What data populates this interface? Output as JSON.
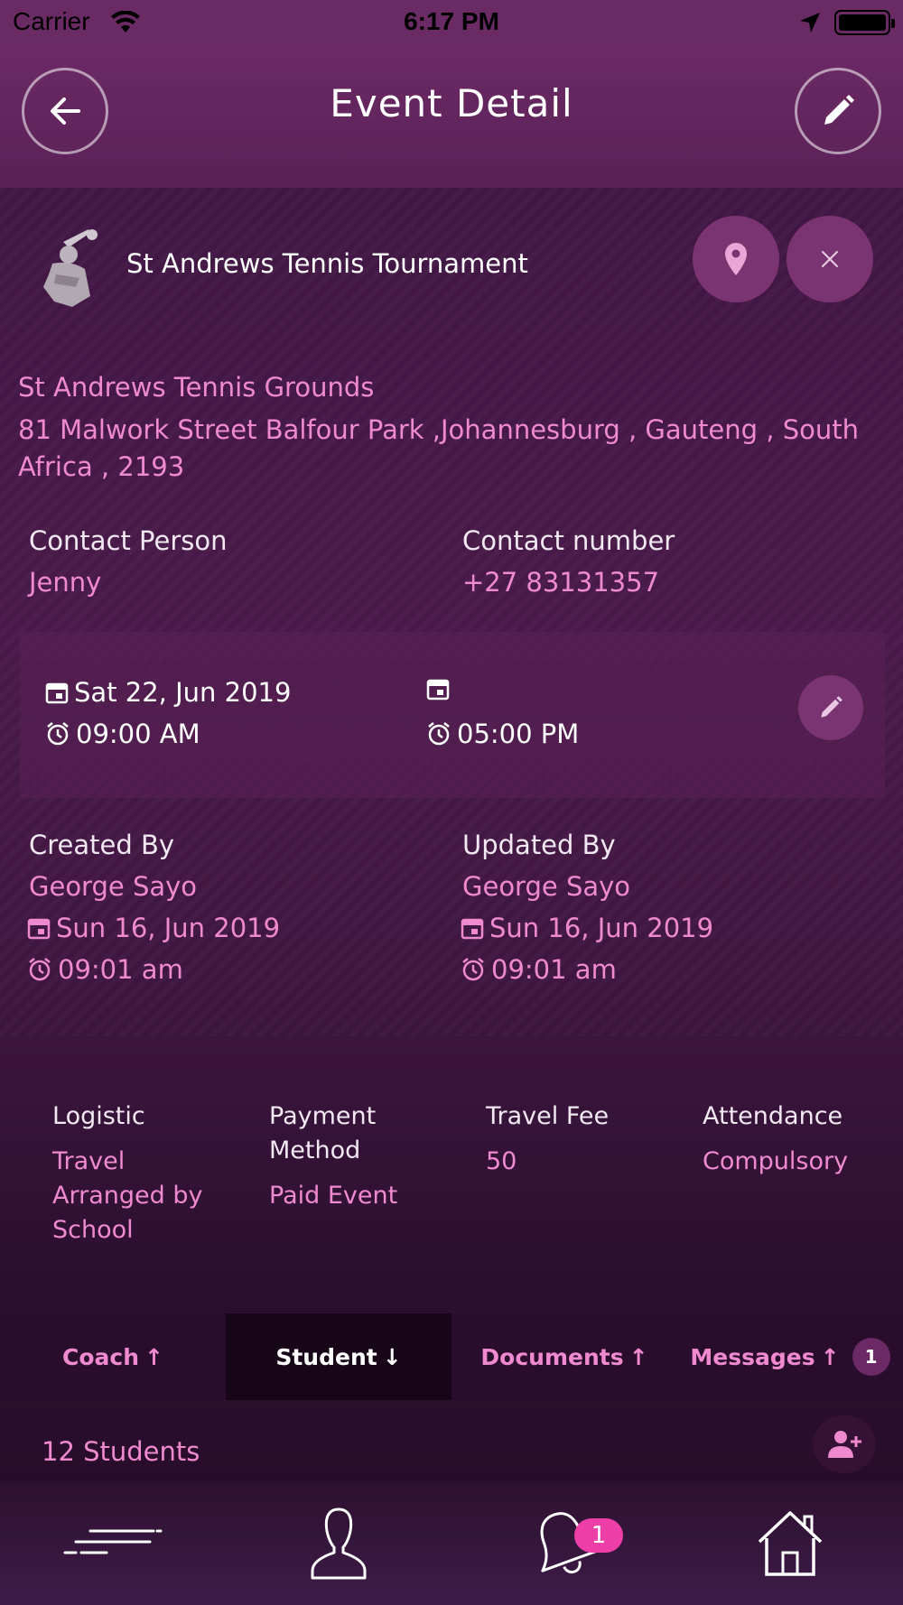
{
  "status_bar": {
    "carrier": "Carrier",
    "time": "6:17 PM"
  },
  "header": {
    "title": "Event Detail"
  },
  "event": {
    "name": "St Andrews Tennis Tournament",
    "venue": "St Andrews Tennis Grounds",
    "address": "81 Malwork Street Balfour Park ,Johannesburg , Gauteng , South Africa , 2193"
  },
  "contact": {
    "person_label": "Contact Person",
    "person_value": "Jenny",
    "number_label": "Contact number",
    "number_value": "+27 83131357"
  },
  "schedule": {
    "start_date": "Sat 22, Jun 2019",
    "start_time": "09:00 AM",
    "end_date": "",
    "end_time": "05:00 PM"
  },
  "audit": {
    "created_label": "Created By",
    "created_name": "George Sayo",
    "created_date": "Sun 16, Jun 2019",
    "created_time": "09:01 am",
    "updated_label": "Updated By",
    "updated_name": "George Sayo",
    "updated_date": "Sun 16, Jun 2019",
    "updated_time": "09:01 am"
  },
  "info": [
    {
      "label": "Logistic",
      "value": "Travel Arranged by School"
    },
    {
      "label": "Payment Method",
      "value": "Paid Event"
    },
    {
      "label": "Travel Fee",
      "value": "50"
    },
    {
      "label": "Attendance",
      "value": "Compulsory"
    }
  ],
  "tabs": [
    {
      "label": "Coach",
      "arrow": "↑"
    },
    {
      "label": "Student",
      "arrow": "↓"
    },
    {
      "label": "Documents",
      "arrow": "↑"
    },
    {
      "label": "Messages",
      "arrow": "↑",
      "badge": "1"
    }
  ],
  "students": {
    "count_text": "12 Students"
  },
  "bottom_nav": {
    "notification_badge": "1"
  },
  "colors": {
    "accent": "#f08ad0",
    "header": "#6c2a66",
    "badge": "#ee3fa9"
  }
}
